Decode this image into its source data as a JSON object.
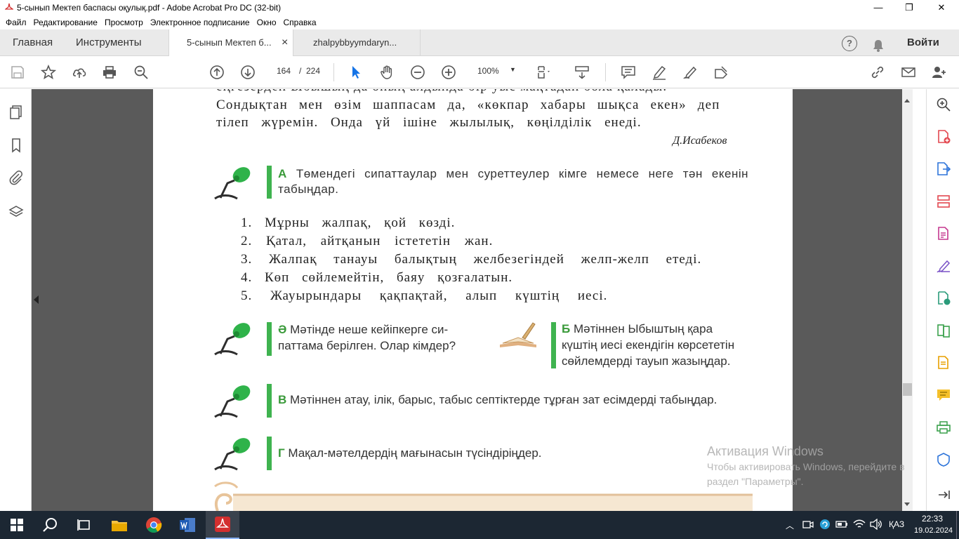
{
  "window": {
    "title": "5-сынып Мектеп баспасы оқулық.pdf - Adobe Acrobat Pro DC (32-bit)",
    "minimize": "—",
    "maximize": "❐",
    "close": "✕"
  },
  "menu": [
    "Файл",
    "Редактирование",
    "Просмотр",
    "Электронное подписание",
    "Окно",
    "Справка"
  ],
  "tabs": {
    "home": "Главная",
    "tools": "Инструменты",
    "doc1": "5-сынып Мектеп б...",
    "doc1_close": "×",
    "doc2": "zhalpybbyymdaryn...",
    "help": "?",
    "signin": "Войти"
  },
  "toolbar": {
    "page_current": "164",
    "page_sep": "/",
    "page_total": "224",
    "zoom": "100%"
  },
  "pdf": {
    "line0": "еңгезерден Ыбышың да оның алдында бір уыс мақтадай бола қалады.",
    "line1": "Сондықтан мен өзім шаппасам да, «көкпар хабары шықса екен» деп",
    "line2": "тілеп жүремін. Онда үй ішіне жылылық, көңілділік енеді.",
    "author": "Д.Исабеков",
    "taskA_letter": "А",
    "taskA_text": "Төмендегі сипаттаулар мен суреттеулер кімге немесе неге тән екенін табыңдар.",
    "items": [
      "1. Мұрны жалпақ, қой көзді.",
      "2. Қатал, айтқанын істететін жан.",
      "3. Жалпақ танауы балықтың желбезегіндей желп-желп етеді.",
      "4. Көп сөйлемейтін, баяу қозғалатын.",
      "5. Жауырындары қақпақтай, алып күштің иесі."
    ],
    "taskAe_letter": "Ә",
    "taskAe_text1": "Мәтінде неше кейіпкерге си-",
    "taskAe_text2": "паттама берілген. Олар кімдер?",
    "taskB_letter": "Б",
    "taskB_text1": "Мәтіннен Ыбыштың қара",
    "taskB_text2": "күштің иесі екендігін көрсететін",
    "taskB_text3": "сөйлемдерді тауып жазыңдар.",
    "taskV_letter": "В",
    "taskV_text": "Мәтіннен атау, ілік, барыс, табыс септіктерде тұрған зат есімдерді табыңдар.",
    "taskG_letter": "Г",
    "taskG_text": "Мақал-мәтелдердің мағынасын түсіндіріңдер."
  },
  "watermark": {
    "line1": "Активация Windows",
    "line2": "Чтобы активировать Windows, перейдите в",
    "line3": "раздел \"Параметры\"."
  },
  "taskbar": {
    "lang": "ҚАЗ",
    "time": "22:33",
    "date": "19.02.2024"
  },
  "colors": {
    "accent_green": "#3fb34f",
    "acrobat_red": "#d32f2f",
    "selection_blue": "#1473e6"
  }
}
